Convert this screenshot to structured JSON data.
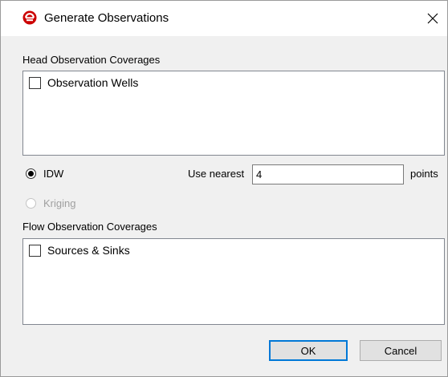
{
  "window": {
    "title": "Generate Observations",
    "close_glyph": "✕",
    "accent_color": "#cc0000"
  },
  "head_section": {
    "label": "Head Observation Coverages",
    "items": [
      {
        "label": "Observation Wells",
        "checked": false
      }
    ]
  },
  "interpolation": {
    "idw_label": "IDW",
    "idw_selected": true,
    "kriging_label": "Kriging",
    "kriging_enabled": false,
    "use_nearest_label": "Use nearest",
    "use_nearest_value": "4",
    "points_label": "points"
  },
  "flow_section": {
    "label": "Flow Observation Coverages",
    "items": [
      {
        "label": "Sources & Sinks",
        "checked": false
      }
    ]
  },
  "buttons": {
    "ok": "OK",
    "cancel": "Cancel"
  }
}
